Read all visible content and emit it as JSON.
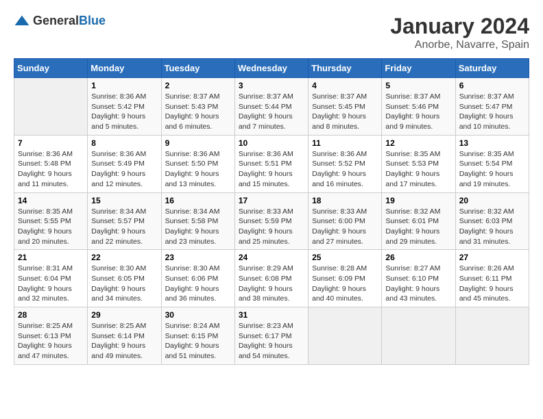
{
  "logo": {
    "general": "General",
    "blue": "Blue"
  },
  "title": "January 2024",
  "subtitle": "Anorbe, Navarre, Spain",
  "days_of_week": [
    "Sunday",
    "Monday",
    "Tuesday",
    "Wednesday",
    "Thursday",
    "Friday",
    "Saturday"
  ],
  "weeks": [
    [
      {
        "day": "",
        "sunrise": "",
        "sunset": "",
        "daylight": ""
      },
      {
        "day": "1",
        "sunrise": "Sunrise: 8:36 AM",
        "sunset": "Sunset: 5:42 PM",
        "daylight": "Daylight: 9 hours and 5 minutes."
      },
      {
        "day": "2",
        "sunrise": "Sunrise: 8:37 AM",
        "sunset": "Sunset: 5:43 PM",
        "daylight": "Daylight: 9 hours and 6 minutes."
      },
      {
        "day": "3",
        "sunrise": "Sunrise: 8:37 AM",
        "sunset": "Sunset: 5:44 PM",
        "daylight": "Daylight: 9 hours and 7 minutes."
      },
      {
        "day": "4",
        "sunrise": "Sunrise: 8:37 AM",
        "sunset": "Sunset: 5:45 PM",
        "daylight": "Daylight: 9 hours and 8 minutes."
      },
      {
        "day": "5",
        "sunrise": "Sunrise: 8:37 AM",
        "sunset": "Sunset: 5:46 PM",
        "daylight": "Daylight: 9 hours and 9 minutes."
      },
      {
        "day": "6",
        "sunrise": "Sunrise: 8:37 AM",
        "sunset": "Sunset: 5:47 PM",
        "daylight": "Daylight: 9 hours and 10 minutes."
      }
    ],
    [
      {
        "day": "7",
        "sunrise": "Sunrise: 8:36 AM",
        "sunset": "Sunset: 5:48 PM",
        "daylight": "Daylight: 9 hours and 11 minutes."
      },
      {
        "day": "8",
        "sunrise": "Sunrise: 8:36 AM",
        "sunset": "Sunset: 5:49 PM",
        "daylight": "Daylight: 9 hours and 12 minutes."
      },
      {
        "day": "9",
        "sunrise": "Sunrise: 8:36 AM",
        "sunset": "Sunset: 5:50 PM",
        "daylight": "Daylight: 9 hours and 13 minutes."
      },
      {
        "day": "10",
        "sunrise": "Sunrise: 8:36 AM",
        "sunset": "Sunset: 5:51 PM",
        "daylight": "Daylight: 9 hours and 15 minutes."
      },
      {
        "day": "11",
        "sunrise": "Sunrise: 8:36 AM",
        "sunset": "Sunset: 5:52 PM",
        "daylight": "Daylight: 9 hours and 16 minutes."
      },
      {
        "day": "12",
        "sunrise": "Sunrise: 8:35 AM",
        "sunset": "Sunset: 5:53 PM",
        "daylight": "Daylight: 9 hours and 17 minutes."
      },
      {
        "day": "13",
        "sunrise": "Sunrise: 8:35 AM",
        "sunset": "Sunset: 5:54 PM",
        "daylight": "Daylight: 9 hours and 19 minutes."
      }
    ],
    [
      {
        "day": "14",
        "sunrise": "Sunrise: 8:35 AM",
        "sunset": "Sunset: 5:55 PM",
        "daylight": "Daylight: 9 hours and 20 minutes."
      },
      {
        "day": "15",
        "sunrise": "Sunrise: 8:34 AM",
        "sunset": "Sunset: 5:57 PM",
        "daylight": "Daylight: 9 hours and 22 minutes."
      },
      {
        "day": "16",
        "sunrise": "Sunrise: 8:34 AM",
        "sunset": "Sunset: 5:58 PM",
        "daylight": "Daylight: 9 hours and 23 minutes."
      },
      {
        "day": "17",
        "sunrise": "Sunrise: 8:33 AM",
        "sunset": "Sunset: 5:59 PM",
        "daylight": "Daylight: 9 hours and 25 minutes."
      },
      {
        "day": "18",
        "sunrise": "Sunrise: 8:33 AM",
        "sunset": "Sunset: 6:00 PM",
        "daylight": "Daylight: 9 hours and 27 minutes."
      },
      {
        "day": "19",
        "sunrise": "Sunrise: 8:32 AM",
        "sunset": "Sunset: 6:01 PM",
        "daylight": "Daylight: 9 hours and 29 minutes."
      },
      {
        "day": "20",
        "sunrise": "Sunrise: 8:32 AM",
        "sunset": "Sunset: 6:03 PM",
        "daylight": "Daylight: 9 hours and 31 minutes."
      }
    ],
    [
      {
        "day": "21",
        "sunrise": "Sunrise: 8:31 AM",
        "sunset": "Sunset: 6:04 PM",
        "daylight": "Daylight: 9 hours and 32 minutes."
      },
      {
        "day": "22",
        "sunrise": "Sunrise: 8:30 AM",
        "sunset": "Sunset: 6:05 PM",
        "daylight": "Daylight: 9 hours and 34 minutes."
      },
      {
        "day": "23",
        "sunrise": "Sunrise: 8:30 AM",
        "sunset": "Sunset: 6:06 PM",
        "daylight": "Daylight: 9 hours and 36 minutes."
      },
      {
        "day": "24",
        "sunrise": "Sunrise: 8:29 AM",
        "sunset": "Sunset: 6:08 PM",
        "daylight": "Daylight: 9 hours and 38 minutes."
      },
      {
        "day": "25",
        "sunrise": "Sunrise: 8:28 AM",
        "sunset": "Sunset: 6:09 PM",
        "daylight": "Daylight: 9 hours and 40 minutes."
      },
      {
        "day": "26",
        "sunrise": "Sunrise: 8:27 AM",
        "sunset": "Sunset: 6:10 PM",
        "daylight": "Daylight: 9 hours and 43 minutes."
      },
      {
        "day": "27",
        "sunrise": "Sunrise: 8:26 AM",
        "sunset": "Sunset: 6:11 PM",
        "daylight": "Daylight: 9 hours and 45 minutes."
      }
    ],
    [
      {
        "day": "28",
        "sunrise": "Sunrise: 8:25 AM",
        "sunset": "Sunset: 6:13 PM",
        "daylight": "Daylight: 9 hours and 47 minutes."
      },
      {
        "day": "29",
        "sunrise": "Sunrise: 8:25 AM",
        "sunset": "Sunset: 6:14 PM",
        "daylight": "Daylight: 9 hours and 49 minutes."
      },
      {
        "day": "30",
        "sunrise": "Sunrise: 8:24 AM",
        "sunset": "Sunset: 6:15 PM",
        "daylight": "Daylight: 9 hours and 51 minutes."
      },
      {
        "day": "31",
        "sunrise": "Sunrise: 8:23 AM",
        "sunset": "Sunset: 6:17 PM",
        "daylight": "Daylight: 9 hours and 54 minutes."
      },
      {
        "day": "",
        "sunrise": "",
        "sunset": "",
        "daylight": ""
      },
      {
        "day": "",
        "sunrise": "",
        "sunset": "",
        "daylight": ""
      },
      {
        "day": "",
        "sunrise": "",
        "sunset": "",
        "daylight": ""
      }
    ]
  ]
}
